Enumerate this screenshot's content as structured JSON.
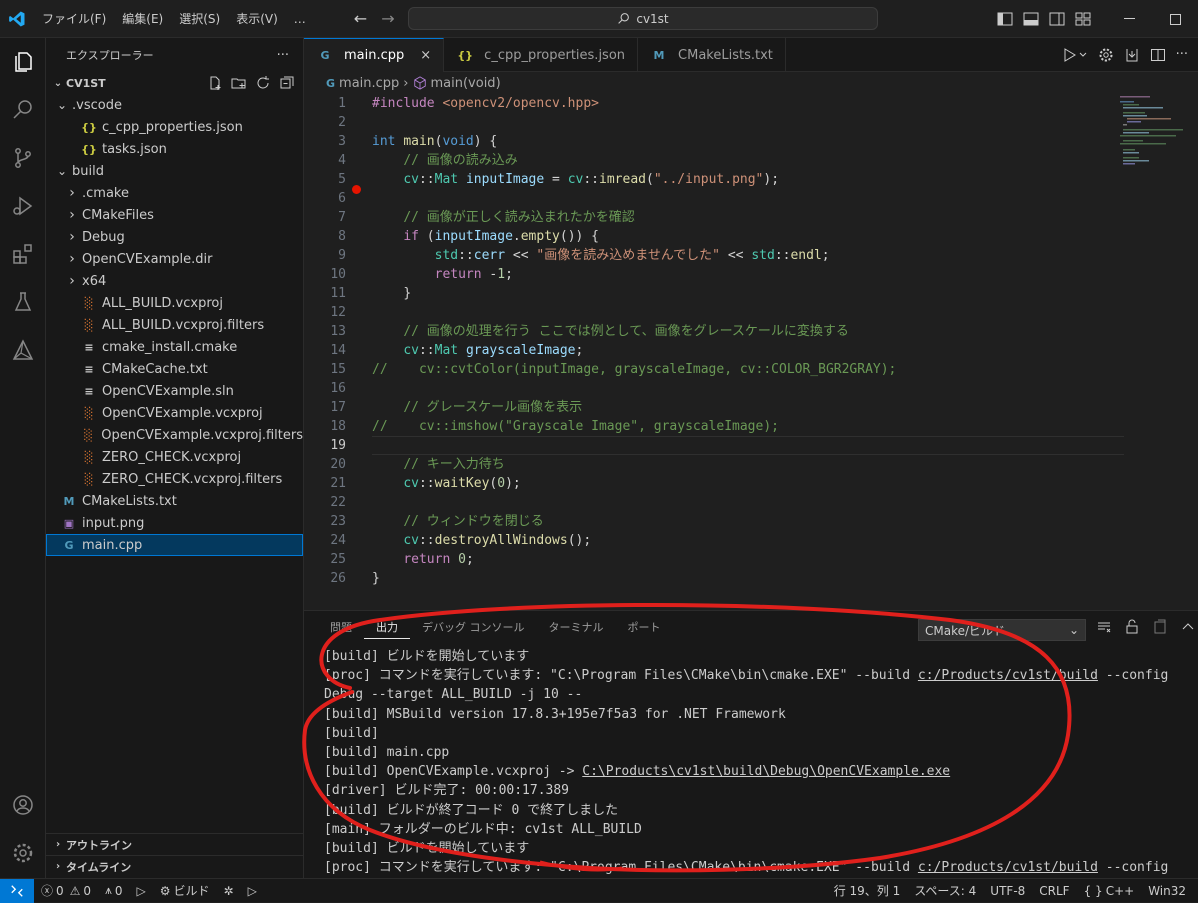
{
  "titlebar": {
    "menus": [
      "ファイル(F)",
      "編集(E)",
      "選択(S)",
      "表示(V)",
      "…"
    ],
    "search": "cv1st"
  },
  "sidebar": {
    "header": "エクスプローラー",
    "more": "···",
    "project": "CV1ST",
    "tree": [
      {
        "label": ".vscode",
        "depth": 1,
        "kind": "folder-open"
      },
      {
        "label": "c_cpp_properties.json",
        "depth": 2,
        "kind": "json"
      },
      {
        "label": "tasks.json",
        "depth": 2,
        "kind": "json"
      },
      {
        "label": "build",
        "depth": 1,
        "kind": "folder-open"
      },
      {
        "label": ".cmake",
        "depth": 2,
        "kind": "folder"
      },
      {
        "label": "CMakeFiles",
        "depth": 2,
        "kind": "folder"
      },
      {
        "label": "Debug",
        "depth": 2,
        "kind": "folder"
      },
      {
        "label": "OpenCVExample.dir",
        "depth": 2,
        "kind": "folder"
      },
      {
        "label": "x64",
        "depth": 2,
        "kind": "folder"
      },
      {
        "label": "ALL_BUILD.vcxproj",
        "depth": 2,
        "kind": "rss"
      },
      {
        "label": "ALL_BUILD.vcxproj.filters",
        "depth": 2,
        "kind": "rss"
      },
      {
        "label": "cmake_install.cmake",
        "depth": 2,
        "kind": "list"
      },
      {
        "label": "CMakeCache.txt",
        "depth": 2,
        "kind": "list"
      },
      {
        "label": "OpenCVExample.sln",
        "depth": 2,
        "kind": "list"
      },
      {
        "label": "OpenCVExample.vcxproj",
        "depth": 2,
        "kind": "rss"
      },
      {
        "label": "OpenCVExample.vcxproj.filters",
        "depth": 2,
        "kind": "rss"
      },
      {
        "label": "ZERO_CHECK.vcxproj",
        "depth": 2,
        "kind": "rss"
      },
      {
        "label": "ZERO_CHECK.vcxproj.filters",
        "depth": 2,
        "kind": "rss"
      },
      {
        "label": "CMakeLists.txt",
        "depth": 1,
        "kind": "cmake"
      },
      {
        "label": "input.png",
        "depth": 1,
        "kind": "image"
      },
      {
        "label": "main.cpp",
        "depth": 1,
        "kind": "cpp",
        "selected": true
      }
    ],
    "outline": "アウトライン",
    "timeline": "タイムライン"
  },
  "editor": {
    "tabs": [
      {
        "label": "main.cpp",
        "icon": "G",
        "active": true,
        "close": "×"
      },
      {
        "label": "c_cpp_properties.json",
        "icon": "{}"
      },
      {
        "label": "CMakeLists.txt",
        "icon": "M"
      }
    ],
    "breadcrumb": {
      "file": "main.cpp",
      "symbol": "main(void)"
    },
    "lines": [
      "1",
      "2",
      "3",
      "4",
      "5",
      "6",
      "7",
      "8",
      "9",
      "10",
      "11",
      "12",
      "13",
      "14",
      "15",
      "16",
      "17",
      "18",
      "19",
      "20",
      "21",
      "22",
      "23",
      "24",
      "25",
      "26"
    ],
    "code": {
      "l1": "#include <opencv2/opencv.hpp>",
      "l4": "// 画像の読み込み",
      "l5a": "cv",
      "l5b": "Mat",
      "l5c": "inputImage",
      "l5d": "cv",
      "l5e": "imread",
      "l5f": "\"../input.png\"",
      "l7": "// 画像が正しく読み込まれたかを確認",
      "l10": "\"画像を読み込めませんでした\"",
      "l13": "// 画像の処理を行う ここでは例として、画像をグレースケールに変換する",
      "l15": "//    cv::cvtColor(inputImage, grayscaleImage, cv::COLOR_BGR2GRAY);",
      "l17": "// グレースケール画像を表示",
      "l18": "//    cv::imshow(\"Grayscale Image\", grayscaleImage);",
      "l20": "// キー入力待ち",
      "l23": "// ウィンドウを閉じる"
    }
  },
  "panel": {
    "tabs": [
      "問題",
      "出力",
      "デバッグ コンソール",
      "ターミナル",
      "ポート"
    ],
    "active_tab": "出力",
    "channel": "CMake/ビルド",
    "output": [
      {
        "a": "[build] ビルドを開始しています"
      },
      {
        "a": "[proc] コマンドを実行しています: \"C:\\Program Files\\CMake\\bin\\cmake.EXE\" --build ",
        "link": "c:/Products/cv1st/build",
        "b": " --config"
      },
      {
        "a": "Debug --target ALL_BUILD -j 10 --"
      },
      {
        "a": "[build] MSBuild version 17.8.3+195e7f5a3 for .NET Framework"
      },
      {
        "a": "[build]"
      },
      {
        "a": "[build]   main.cpp"
      },
      {
        "a": "[build]   OpenCVExample.vcxproj -> ",
        "link": "C:\\Products\\cv1st\\build\\Debug\\OpenCVExample.exe"
      },
      {
        "a": "[driver] ビルド完了: 00:00:17.389"
      },
      {
        "a": "[build] ビルドが終了コード 0 で終了しました"
      },
      {
        "a": "[main] フォルダーのビルド中: cv1st ALL_BUILD"
      },
      {
        "a": "[build] ビルドを開始しています"
      },
      {
        "a": "[proc] コマンドを実行しています: \"C:\\Program Files\\CMake\\bin\\cmake.EXE\" --build ",
        "link": "c:/Products/cv1st/build",
        "b": " --config"
      }
    ]
  },
  "status": {
    "errors": "0",
    "warnings": "0",
    "ports": "0",
    "build": "ビルド",
    "position": "行 19、列 1",
    "spaces": "スペース: 4",
    "encoding": "UTF-8",
    "eol": "CRLF",
    "language": "C++",
    "platform": "Win32",
    "lang_icon": "{ }"
  },
  "colors": {
    "accent": "#0078d4",
    "annotation": "#e0201c"
  }
}
